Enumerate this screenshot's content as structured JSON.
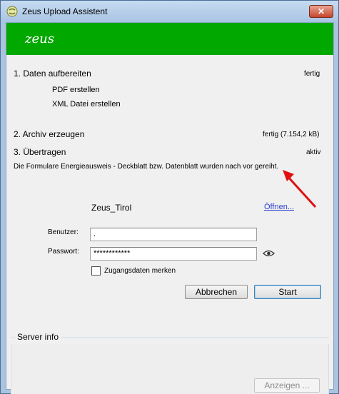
{
  "window": {
    "title": "Zeus Upload Assistent",
    "close_label": "✕"
  },
  "banner": {
    "logo_text": "zeus",
    "color": "#00a800"
  },
  "steps": {
    "step1": {
      "label": "1. Daten aufbereiten",
      "status": "fertig"
    },
    "step1_items": [
      "PDF erstellen",
      "XML Datei erstellen"
    ],
    "step2": {
      "label": "2. Archiv erzeugen",
      "status": "fertig (7.154,2 kB)"
    },
    "step3": {
      "label": "3. Übertragen",
      "status": "aktiv"
    },
    "message": "Die Formulare Energieausweis - Deckblatt bzw. Datenblatt wurden nach vor gereiht."
  },
  "target": {
    "name": "Zeus_Tirol",
    "open_link": "Öffnen..."
  },
  "login": {
    "user_label": "Benutzer:",
    "user_value": ".",
    "password_label": "Passwort:",
    "password_value": "************",
    "remember_label": "Zugangsdaten merken",
    "remember_checked": false
  },
  "buttons": {
    "cancel": "Abbrechen",
    "start": "Start",
    "show": "Anzeigen ..."
  },
  "server_info": {
    "legend": "Server info"
  },
  "colors": {
    "arrow": "#e01010",
    "link": "#2a3fd0"
  },
  "icons": {
    "eye": "eye-icon",
    "app": "zeus-app-icon"
  }
}
